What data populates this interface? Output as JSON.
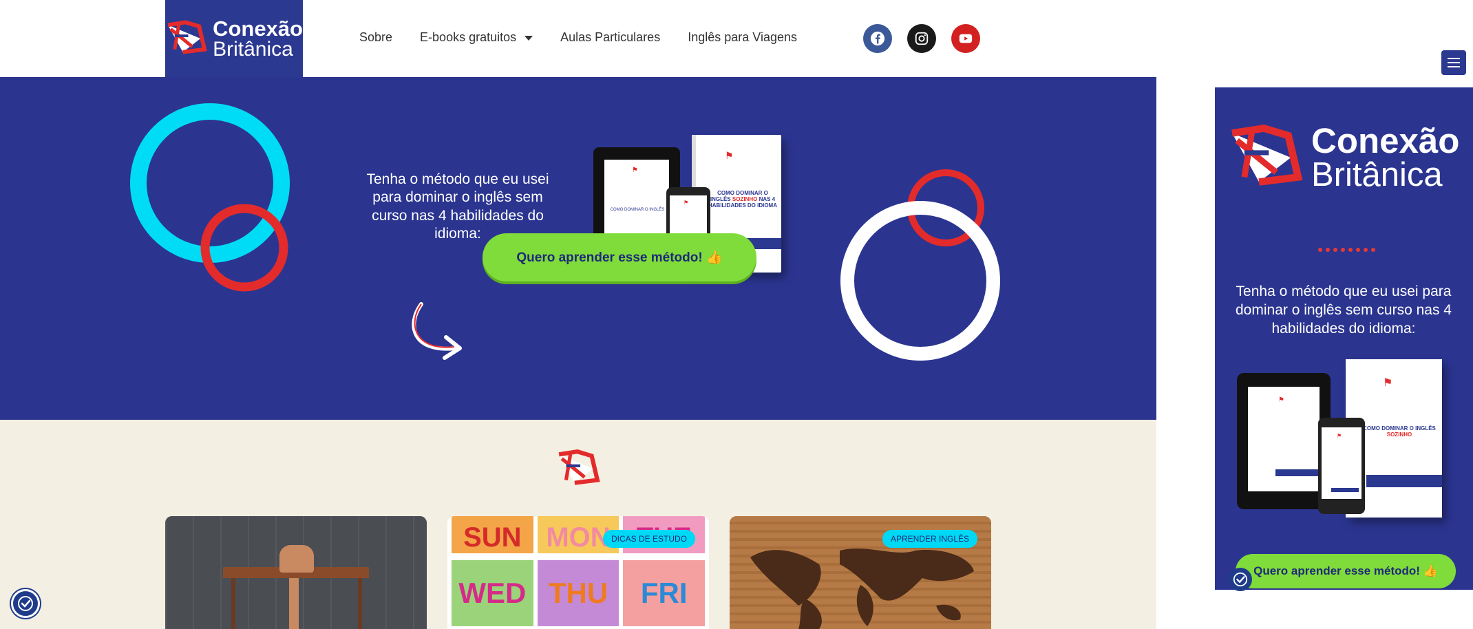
{
  "header": {
    "logo_line1": "Conexão",
    "logo_line2": "Britânica",
    "nav": [
      "Sobre",
      "E-books gratuitos",
      "Aulas Particulares",
      "Inglês para Viagens"
    ],
    "social": [
      {
        "name": "facebook-icon",
        "color": "#3b5998"
      },
      {
        "name": "instagram-icon",
        "color": "#1a1a1a"
      },
      {
        "name": "youtube-icon",
        "color": "#d32020"
      }
    ]
  },
  "hero": {
    "text": "Tenha o método que eu usei para dominar o inglês sem curso nas 4 habilidades do idioma:",
    "cta": "Quero aprender esse método! 👍",
    "ebook_title_a": "COMO DOMINAR O INGLÊS",
    "ebook_title_b": "SOZINHO",
    "ebook_title_c": "NAS 4 HABILIDADES DO IDIOMA",
    "colors": {
      "bg": "#2b3590",
      "cyan": "#00dcf5",
      "red": "#e42b2b",
      "green": "#80dc3a"
    }
  },
  "cards": [
    {
      "badge": ""
    },
    {
      "badge": "DICAS DE ESTUDO",
      "days": [
        "SUN",
        "MON",
        "TUE",
        "WED",
        "THU",
        "FRI"
      ]
    },
    {
      "badge": "APRENDER INGLÊS"
    }
  ],
  "side_panel": {
    "logo_line1": "Conexão",
    "logo_line2": "Britânica",
    "text": "Tenha o método que eu usei para dominar o inglês sem curso nas 4 habilidades do idioma:",
    "cta": "Quero aprender esse método! 👍"
  }
}
